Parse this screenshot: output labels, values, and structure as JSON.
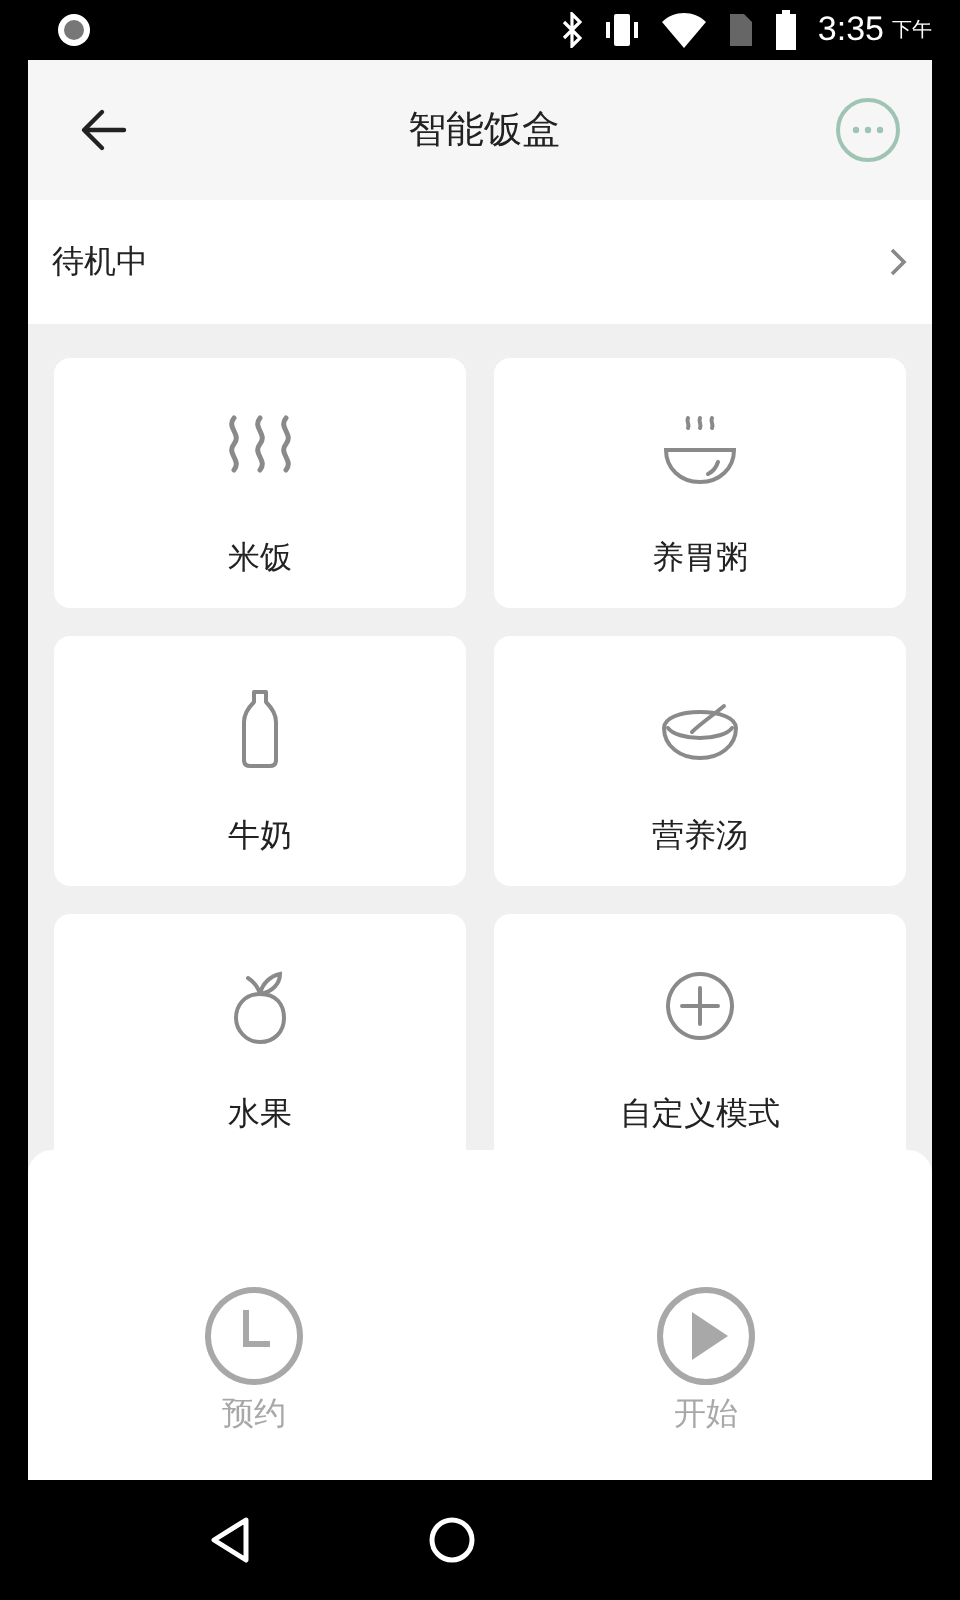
{
  "status_bar": {
    "time": "3:35",
    "period": "下午"
  },
  "header": {
    "title": "智能饭盒"
  },
  "device_status": {
    "text": "待机中"
  },
  "modes": [
    {
      "label": "米饭",
      "kind": "steam"
    },
    {
      "label": "养胃粥",
      "kind": "bowl"
    },
    {
      "label": "牛奶",
      "kind": "bottle"
    },
    {
      "label": "营养汤",
      "kind": "soup"
    },
    {
      "label": "水果",
      "kind": "fruit"
    },
    {
      "label": "自定义模式",
      "kind": "add"
    }
  ],
  "actions": [
    {
      "label": "预约",
      "kind": "schedule",
      "disabled": true
    },
    {
      "label": "开始",
      "kind": "start",
      "disabled": true
    }
  ]
}
